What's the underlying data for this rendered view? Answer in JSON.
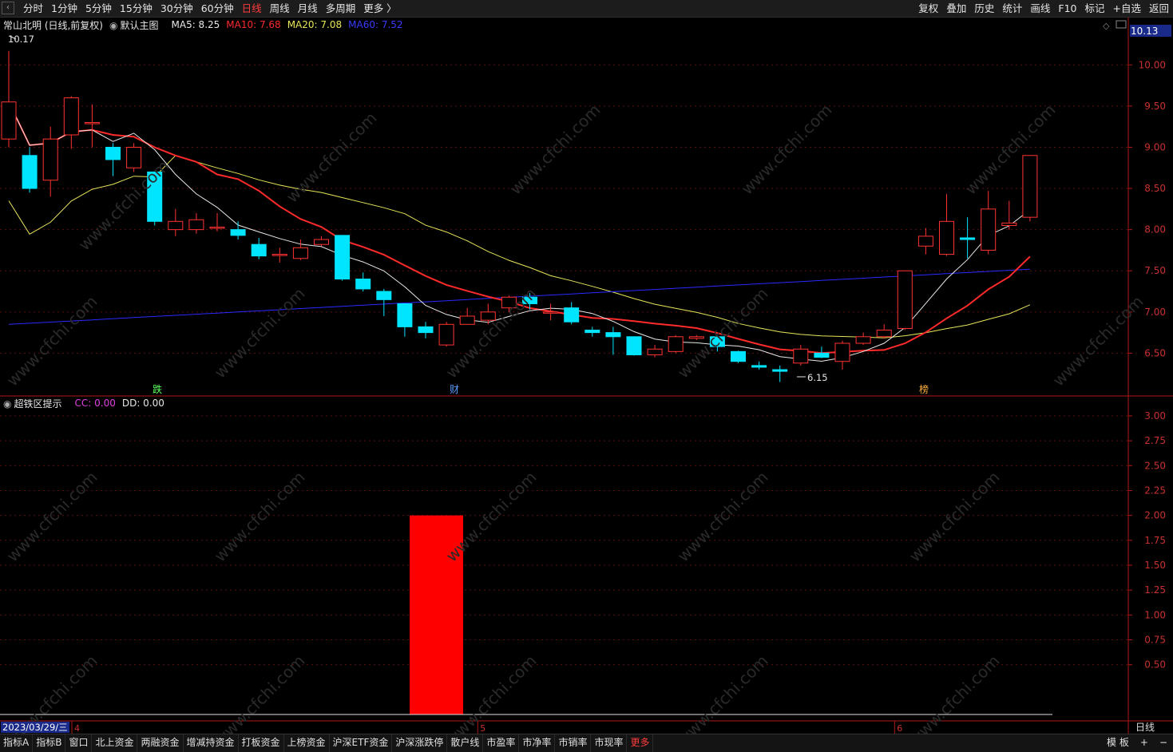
{
  "topbar": {
    "back_icon": "‹",
    "period_tabs": [
      "分时",
      "1分钟",
      "5分钟",
      "15分钟",
      "30分钟",
      "60分钟",
      "日线",
      "周线",
      "月线",
      "多周期",
      "更多 〉"
    ],
    "active_tab": "日线",
    "tools": [
      "复权",
      "叠加",
      "历史",
      "统计",
      "画线",
      "F10",
      "标记",
      "+自选",
      "返回"
    ]
  },
  "main_chart": {
    "stock_title": "常山北明 (日线,前复权)",
    "template": "默认主图",
    "ma": [
      {
        "label": "MA5: 8.25",
        "color": "#e8e8e8"
      },
      {
        "label": "MA10: 7.68",
        "color": "#ff2a2a"
      },
      {
        "label": "MA20: 7.08",
        "color": "#e6e65a"
      },
      {
        "label": "MA60: 7.52",
        "color": "#2a2aff"
      }
    ],
    "price_label": "10.13",
    "y_ticks": [
      "10.00",
      "9.50",
      "9.00",
      "8.50",
      "8.00",
      "7.50",
      "7.00",
      "6.50"
    ],
    "high_mark": "10.17",
    "low_mark": "6.15",
    "markers": [
      "跌",
      "财",
      "榜"
    ]
  },
  "indicator": {
    "name": "超铁区提示",
    "cc": "CC: 0.00",
    "dd": "DD: 0.00",
    "y_ticks": [
      "3.00",
      "2.75",
      "2.50",
      "2.25",
      "2.00",
      "1.75",
      "1.50",
      "1.25",
      "1.00",
      "0.75",
      "0.50"
    ]
  },
  "xaxis": {
    "date_label": "2023/03/29/三",
    "month_labels": [
      "4",
      "5",
      "6"
    ],
    "right_label": "日线"
  },
  "watermark": "www.cfchi.com",
  "bottombar": {
    "tabs": [
      "指标A",
      "指标B",
      "窗口",
      "北上资金",
      "两融资金",
      "增减持资金",
      "打板资金",
      "上榜资金",
      "沪深ETF资金",
      "沪深涨跌停",
      "散户线",
      "市盈率",
      "市净率",
      "市销率",
      "市现率",
      "更多"
    ],
    "right_buttons": [
      "模 板",
      "+",
      "−"
    ]
  },
  "chart_data": {
    "type": "candlestick",
    "candles": [
      [
        9.1,
        9.55,
        10.17,
        9.0
      ],
      [
        8.9,
        8.5,
        9.0,
        8.45
      ],
      [
        8.6,
        9.1,
        9.25,
        8.4
      ],
      [
        9.15,
        9.6,
        9.62,
        8.98
      ],
      [
        9.3,
        9.3,
        9.52,
        9.0
      ],
      [
        9.0,
        8.85,
        9.05,
        8.65
      ],
      [
        8.75,
        9.0,
        9.05,
        8.7
      ],
      [
        8.7,
        8.1,
        8.7,
        8.05
      ],
      [
        8.0,
        8.1,
        8.25,
        7.92
      ],
      [
        8.0,
        8.12,
        8.2,
        7.95
      ],
      [
        8.02,
        8.03,
        8.2,
        7.98
      ],
      [
        8.0,
        7.93,
        8.1,
        7.88
      ],
      [
        7.82,
        7.68,
        7.9,
        7.64
      ],
      [
        7.7,
        7.7,
        7.78,
        7.6
      ],
      [
        7.65,
        7.78,
        7.88,
        7.63
      ],
      [
        7.82,
        7.88,
        7.92,
        7.8
      ],
      [
        7.93,
        7.4,
        7.93,
        7.38
      ],
      [
        7.4,
        7.28,
        7.48,
        7.25
      ],
      [
        7.25,
        7.15,
        7.28,
        6.95
      ],
      [
        7.1,
        6.82,
        7.1,
        6.7
      ],
      [
        6.82,
        6.75,
        6.88,
        6.68
      ],
      [
        6.6,
        6.85,
        6.88,
        6.58
      ],
      [
        6.85,
        6.95,
        7.05,
        6.85
      ],
      [
        6.9,
        7.0,
        7.1,
        6.85
      ],
      [
        7.05,
        7.18,
        7.2,
        7.0
      ],
      [
        7.18,
        7.1,
        7.23,
        7.03
      ],
      [
        7.0,
        7.0,
        7.1,
        6.9
      ],
      [
        7.05,
        6.88,
        7.12,
        6.85
      ],
      [
        6.78,
        6.75,
        6.82,
        6.7
      ],
      [
        6.75,
        6.7,
        6.82,
        6.48
      ],
      [
        6.7,
        6.48,
        6.7,
        6.47
      ],
      [
        6.48,
        6.55,
        6.6,
        6.45
      ],
      [
        6.52,
        6.7,
        6.72,
        6.5
      ],
      [
        6.68,
        6.7,
        6.72,
        6.66
      ],
      [
        6.7,
        6.58,
        6.73,
        6.52
      ],
      [
        6.52,
        6.4,
        6.53,
        6.38
      ],
      [
        6.35,
        6.33,
        6.4,
        6.3
      ],
      [
        6.3,
        6.28,
        6.35,
        6.15
      ],
      [
        6.38,
        6.55,
        6.6,
        6.35
      ],
      [
        6.5,
        6.45,
        6.58,
        6.44
      ],
      [
        6.4,
        6.62,
        6.65,
        6.3
      ],
      [
        6.62,
        6.7,
        6.75,
        6.6
      ],
      [
        6.7,
        6.78,
        6.85,
        6.68
      ],
      [
        6.8,
        7.5,
        7.5,
        6.78
      ],
      [
        7.8,
        7.92,
        8.02,
        7.7
      ],
      [
        7.7,
        8.1,
        8.43,
        7.68
      ],
      [
        7.9,
        7.88,
        8.15,
        7.65
      ],
      [
        7.75,
        8.25,
        8.47,
        7.7
      ],
      [
        8.05,
        8.08,
        8.35,
        8.0
      ],
      [
        8.15,
        8.9,
        8.9,
        8.1
      ]
    ],
    "ma5_last": 8.25,
    "ma10_last": 7.68,
    "ma20_last": 7.08,
    "ma60_last": 7.52,
    "y_range": [
      6.0,
      10.4
    ],
    "indicator_bars": [
      {
        "index": 20.5,
        "value": 2.0
      }
    ],
    "indicator_y_range": [
      0,
      3.2
    ]
  }
}
